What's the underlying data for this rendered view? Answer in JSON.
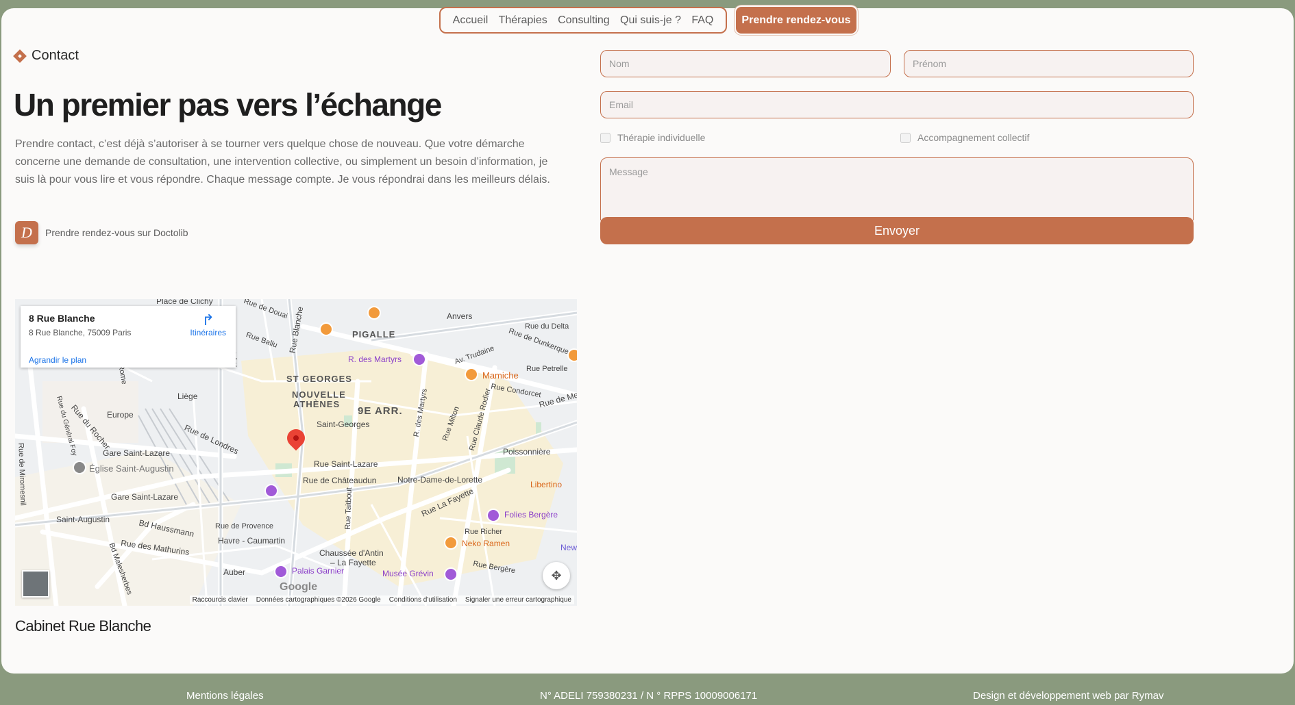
{
  "nav": {
    "items": [
      "Accueil",
      "Thérapies",
      "Consulting",
      "Qui suis-je ?",
      "FAQ"
    ],
    "cta": "Prendre rendez-vous"
  },
  "contact": {
    "eyebrow": "Contact",
    "title": "Un premier pas vers l’échange",
    "intro": "Prendre contact, c’est déjà s’autoriser à se tourner vers quelque chose de nouveau. Que votre démarche concerne une demande de consultation, une intervention collective, ou simplement un besoin d’information, je suis là pour vous lire et vous répondre. Chaque message compte. Je vous répondrai dans les meilleurs délais.",
    "doctolib_logo": "D",
    "doctolib_label": "Prendre rendez-vous sur Doctolib"
  },
  "map": {
    "place_name": "8 Rue Blanche",
    "address": "8 Rue Blanche, 75009 Paris",
    "directions": "Itinéraires",
    "enlarge": "Agrandir le plan",
    "google": "Google",
    "attribution": [
      "Raccourcis clavier",
      "Données cartographiques ©2026 Google",
      "Conditions d'utilisation",
      "Signaler une erreur cartographique"
    ],
    "labels": {
      "pigalle": "PIGALLE",
      "st_georges": "ST GEORGES",
      "nouvelle": "NOUVELLE",
      "athenes": "ATHÈNES",
      "arr": "9E ARR.",
      "martyrs": "R. des Martyrs",
      "mamiche": "Mamiche",
      "anvers": "Anvers",
      "liege": "Liège",
      "europe": "Europe",
      "saint_georges": "Saint-Georges",
      "gare_st_lazare": "Gare Saint-Lazare",
      "eglise": "Église Saint-Augustin",
      "gare_st_lazare_m": "Gare Saint-Lazare",
      "saint_augustin": "Saint-Augustin",
      "rue_st_lazare": "Rue Saint-Lazare",
      "rue_chateaudun": "Rue de Châteaudun",
      "ndl": "Notre-Dame-de-Lorette",
      "poissonniere": "Poissonnière",
      "libertino": "Libertino",
      "folies": "Folies Bergère",
      "neko": "Neko Ramen",
      "havre": "Havre - Caumartin",
      "chaussee": "Chaussée d'Antin",
      "la_fayette": "– La Fayette",
      "auber": "Auber",
      "palais": "Palais Garnier",
      "grevin": "Musée Grévin",
      "bd_haussmann": "Bd Haussmann",
      "rue_mathurins": "Rue des Mathurins",
      "rue_londres": "Rue de Londres",
      "rue_rocher": "Rue du Rocher",
      "rue_lafayette": "Rue La Fayette",
      "rue_blanche": "Rue Blanche",
      "rue_clichy": "Clichy",
      "place_clichy": "Place de Clichy",
      "rue_douai": "Rue de Douai",
      "rue_ballu": "Rue Ballu",
      "rue_delta": "Rue du Delta",
      "rue_dunkerque": "Rue de Dunkerque",
      "av_trudaine": "Av. Trudaine",
      "rue_petrelle": "Rue Petrelle",
      "rue_condorcet": "Rue Condorcet",
      "rue_de_me": "Rue de Me",
      "rue_milton": "Rue Milton",
      "rue_rodier": "Rue Claude Rodier",
      "rue_martyrs_v": "R. des Martyrs",
      "rue_taitbout": "Rue Taitbout",
      "rue_provence": "Rue de Provence",
      "rue_richer": "Rue Richer",
      "rue_bergere": "Rue Bergère",
      "rue_miromesnil": "Rue de Miromesnil",
      "bd_malesherbes": "Bd Malesherbes",
      "rue_general_foy": "Rue du Général Foy",
      "rome": "Rome",
      "new": "New"
    }
  },
  "cabinet_title": "Cabinet Rue Blanche",
  "form": {
    "nom_placeholder": "Nom",
    "prenom_placeholder": "Prénom",
    "email_placeholder": "Email",
    "option1": "Thérapie individuelle",
    "option2": "Accompagnement collectif",
    "message_placeholder": "Message",
    "submit": "Envoyer"
  },
  "footer": {
    "legal": "Mentions légales",
    "adeli": "N° ADELI 759380231 / N ° RPPS 10009006171",
    "credit": "Design et développement web par Rymav"
  },
  "colors": {
    "accent": "#c4704c",
    "footer_bg": "#8a9a7e",
    "card_bg": "#fbfaf9"
  }
}
